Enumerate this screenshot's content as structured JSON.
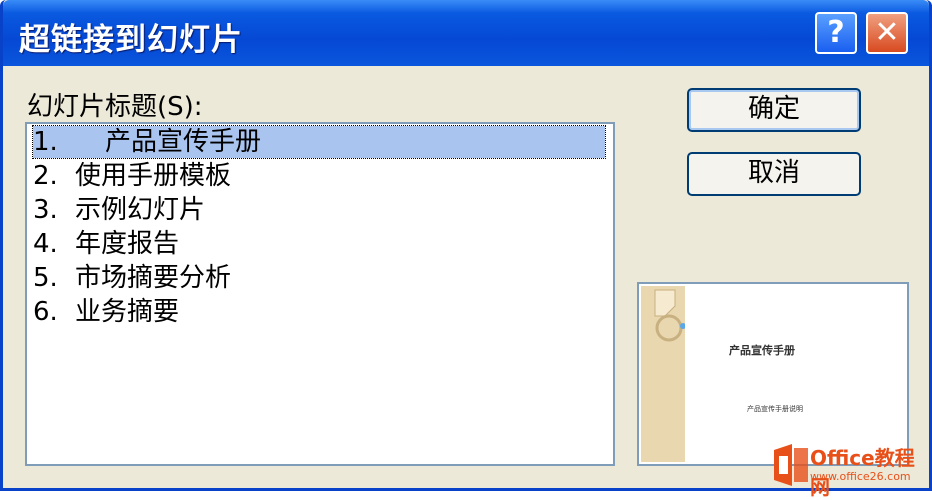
{
  "window": {
    "title": "超链接到幻灯片"
  },
  "titlebar": {
    "help_label": "?",
    "close_label": "✕"
  },
  "slides_label": "幻灯片标题(S):",
  "slides": [
    {
      "number": "1.",
      "title": "产品宣传手册"
    },
    {
      "number": "2.",
      "title": "使用手册模板"
    },
    {
      "number": "3.",
      "title": "示例幻灯片"
    },
    {
      "number": "4.",
      "title": "年度报告"
    },
    {
      "number": "5.",
      "title": "市场摘要分析"
    },
    {
      "number": "6.",
      "title": "业务摘要"
    }
  ],
  "buttons": {
    "ok_label": "确定",
    "cancel_label": "取消"
  },
  "preview": {
    "slide_title": "产品宣传手册",
    "slide_subtitle": "产品宣传手册说明"
  },
  "watermark": {
    "brand": "Office教程网",
    "url": "www.office26.com"
  },
  "colors": {
    "titlebar": "#0548d4",
    "selection": "#aac4f0",
    "dialog_bg": "#ece9d8"
  }
}
